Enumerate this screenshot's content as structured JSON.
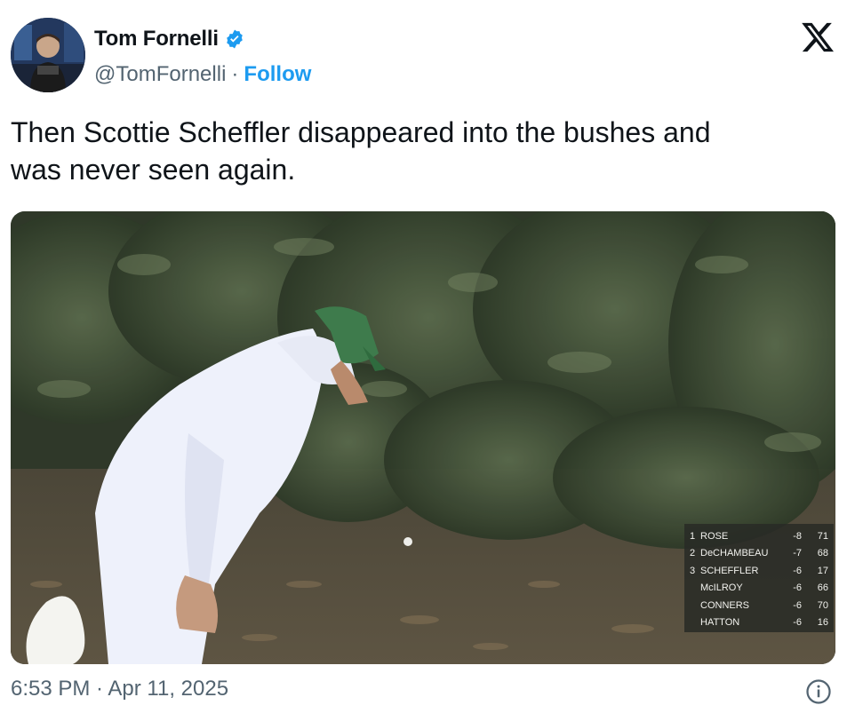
{
  "author": {
    "name": "Tom Fornelli",
    "handle": "@TomFornelli",
    "separator": "·",
    "follow_label": "Follow"
  },
  "tweet": {
    "text": "Then Scottie Scheffler disappeared into the bushes and\nwas never seen again."
  },
  "media": {
    "description_icon": "video-frame",
    "scoreboard": [
      {
        "pos": "1",
        "name": "ROSE",
        "score": "-8",
        "hole": "71"
      },
      {
        "pos": "2",
        "name": "DeCHAMBEAU",
        "score": "-7",
        "hole": "68"
      },
      {
        "pos": "3",
        "name": "SCHEFFLER",
        "score": "-6",
        "hole": "17"
      },
      {
        "pos": "",
        "name": "McILROY",
        "score": "-6",
        "hole": "66"
      },
      {
        "pos": "",
        "name": "CONNERS",
        "score": "-6",
        "hole": "70"
      },
      {
        "pos": "",
        "name": "HATTON",
        "score": "-6",
        "hole": "16"
      }
    ]
  },
  "footer": {
    "timestamp": "6:53 PM · Apr 11, 2025"
  },
  "colors": {
    "accent": "#1d9bf0",
    "secondary_text": "#536471",
    "primary_text": "#0f1419"
  },
  "icons": [
    "verified-badge-icon",
    "x-logo-icon",
    "info-icon"
  ]
}
